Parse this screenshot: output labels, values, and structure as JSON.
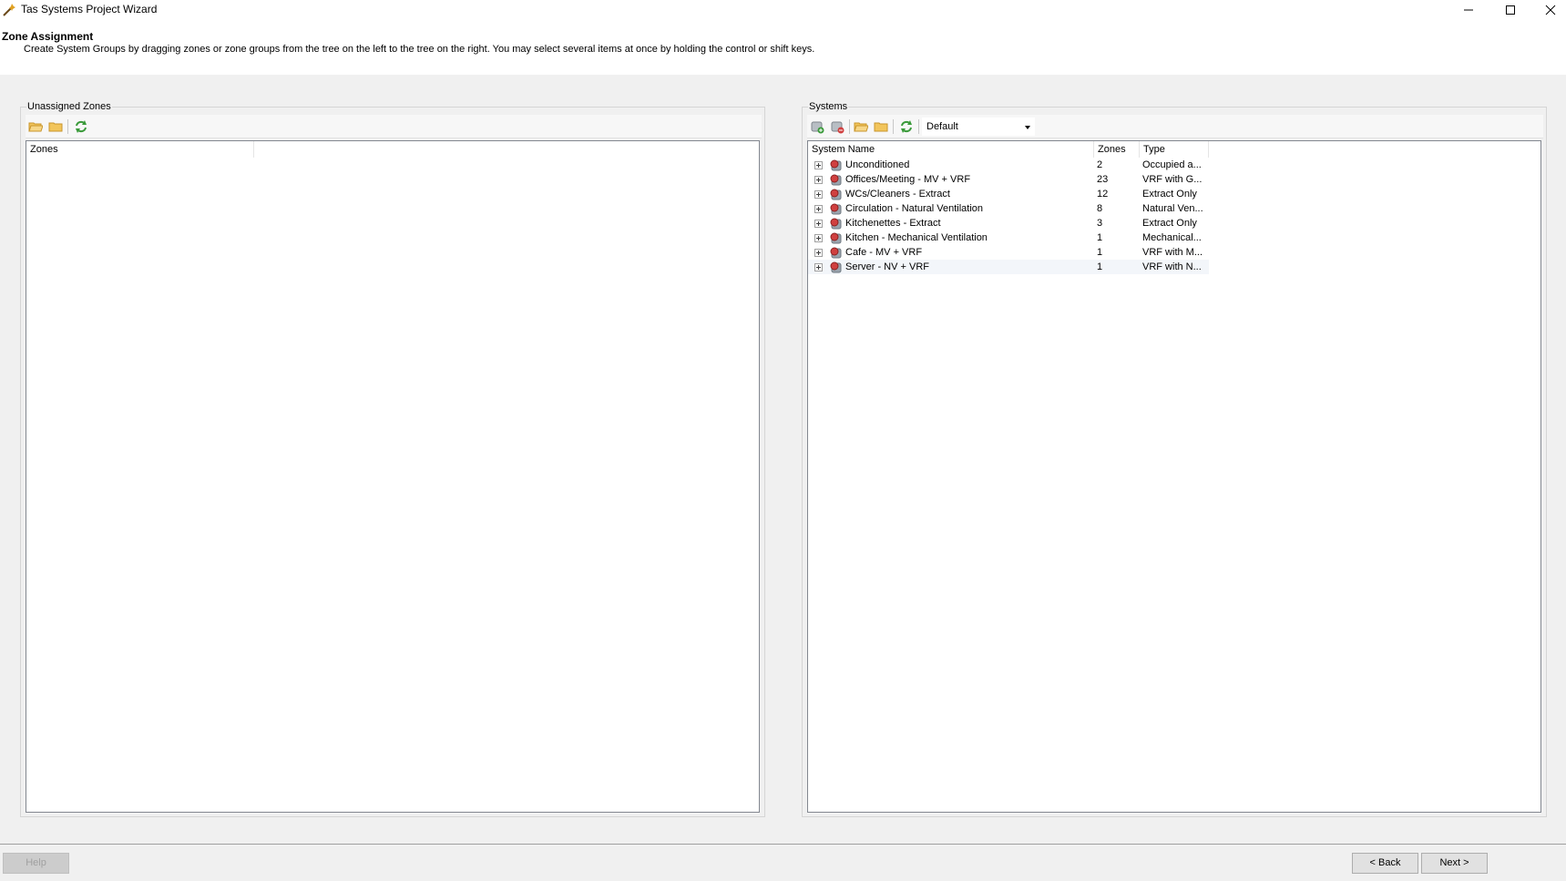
{
  "window": {
    "title": "Tas Systems Project Wizard",
    "minimize_icon": "minimize-icon",
    "maximize_icon": "maximize-icon",
    "close_icon": "close-icon"
  },
  "header": {
    "title": "Zone Assignment",
    "description": "Create System Groups by dragging zones or zone groups from the tree on the left to the tree on the right.  You may select several items at once by holding the control or shift keys."
  },
  "left_panel": {
    "label": "Unassigned Zones",
    "toolbar_icons": [
      "folder-open-icon",
      "folder-icon",
      "refresh-icon"
    ],
    "columns": [
      "Zones"
    ],
    "rows": []
  },
  "right_panel": {
    "label": "Systems",
    "toolbar_icons": [
      "add-system-icon",
      "remove-system-icon",
      "folder-open-icon",
      "folder-icon",
      "refresh-icon"
    ],
    "combo_value": "Default",
    "columns": [
      "System Name",
      "Zones",
      "Type"
    ],
    "rows": [
      {
        "name": "Unconditioned",
        "zones": "2",
        "type": "Occupied a..."
      },
      {
        "name": "Offices/Meeting - MV + VRF",
        "zones": "23",
        "type": "VRF with G..."
      },
      {
        "name": "WCs/Cleaners - Extract",
        "zones": "12",
        "type": "Extract Only"
      },
      {
        "name": "Circulation - Natural Ventilation",
        "zones": "8",
        "type": "Natural Ven..."
      },
      {
        "name": "Kitchenettes - Extract",
        "zones": "3",
        "type": "Extract Only"
      },
      {
        "name": "Kitchen - Mechanical Ventilation",
        "zones": "1",
        "type": "Mechanical..."
      },
      {
        "name": "Cafe - MV + VRF",
        "zones": "1",
        "type": "VRF with M..."
      },
      {
        "name": "Server - NV + VRF",
        "zones": "1",
        "type": "VRF with N..."
      }
    ]
  },
  "footer": {
    "help": "Help",
    "back": "< Back",
    "next": "Next >"
  },
  "colors": {
    "accent_folder": "#e8b84a",
    "refresh": "#3a9a3a",
    "system_icon_red": "#d04040",
    "system_icon_grey": "#9aa4ae"
  }
}
